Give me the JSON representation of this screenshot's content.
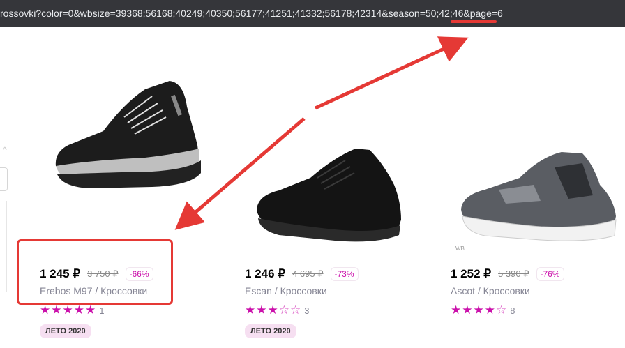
{
  "address_bar": {
    "url": "rossovki?color=0&wbsize=39368;56168;40249;40350;56177;41251;41332;56178;42314&season=50;42;46&page=6"
  },
  "products": [
    {
      "price": "1 245 ₽",
      "old_price": "3 750 ₽",
      "discount": "-66%",
      "title": "Erebos M97 / Кроссовки",
      "rating": 5,
      "reviews": "1",
      "badge": "ЛЕТО 2020"
    },
    {
      "price": "1 246 ₽",
      "old_price": "4 695 ₽",
      "discount": "-73%",
      "title": "Escan / Кроссовки",
      "rating": 3,
      "reviews": "3",
      "badge": "ЛЕТО 2020"
    },
    {
      "price": "1 252 ₽",
      "old_price": "5 390 ₽",
      "discount": "-76%",
      "title": "Ascot / Кроссовки",
      "rating": 4,
      "reviews": "8",
      "wb_mark": "WB"
    }
  ],
  "colors": {
    "accent": "#cb11ab",
    "annotation": "#e53935",
    "urlbar_bg": "#35363a"
  }
}
